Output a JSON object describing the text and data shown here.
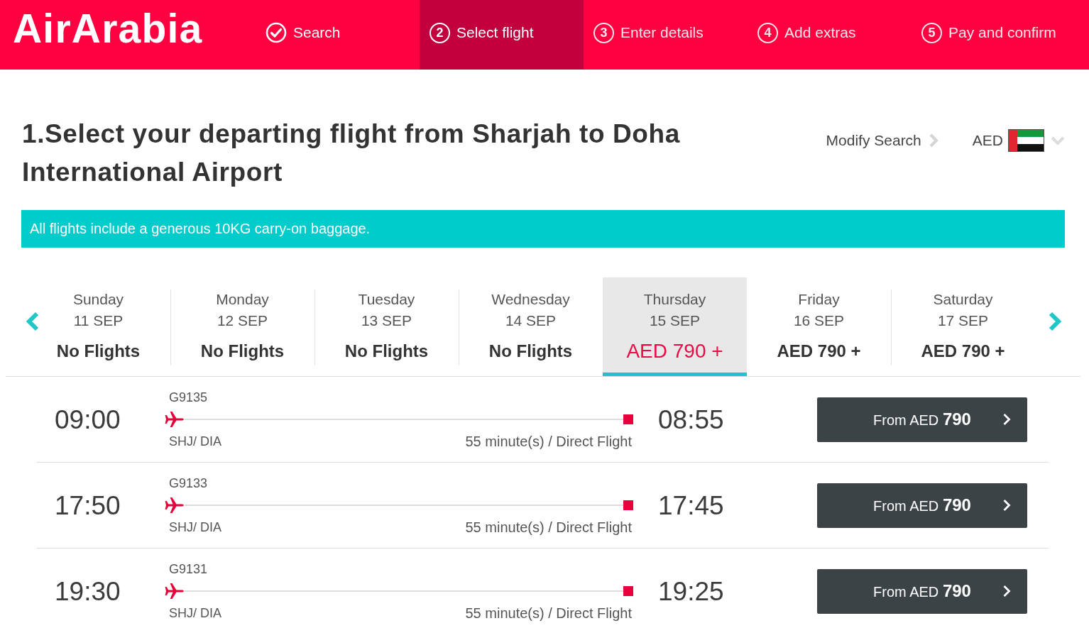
{
  "header": {
    "logo": "AirArabia",
    "steps": [
      {
        "kind": "done",
        "label": "Search",
        "selected": false
      },
      {
        "kind": "numbered",
        "number": "2",
        "label": "Select flight",
        "selected": true
      },
      {
        "kind": "numbered",
        "number": "3",
        "label": "Enter details",
        "selected": false
      },
      {
        "kind": "numbered",
        "number": "4",
        "label": "Add extras",
        "selected": false
      },
      {
        "kind": "numbered",
        "number": "5",
        "label": "Pay and confirm",
        "selected": false
      }
    ]
  },
  "heading": {
    "title": "1.Select your departing flight from Sharjah to Doha International Airport",
    "modify_search": "Modify Search",
    "currency": "AED"
  },
  "notice": "All flights include a generous 10KG carry-on baggage.",
  "date_strip": {
    "days": [
      {
        "day": "Sunday",
        "date": "11 SEP",
        "price": "No Flights",
        "selected": false
      },
      {
        "day": "Monday",
        "date": "12 SEP",
        "price": "No Flights",
        "selected": false
      },
      {
        "day": "Tuesday",
        "date": "13 SEP",
        "price": "No Flights",
        "selected": false
      },
      {
        "day": "Wednesday",
        "date": "14 SEP",
        "price": "No Flights",
        "selected": false
      },
      {
        "day": "Thursday",
        "date": "15 SEP",
        "price": "AED 790 +",
        "selected": true
      },
      {
        "day": "Friday",
        "date": "16 SEP",
        "price": "AED 790 +",
        "selected": false
      },
      {
        "day": "Saturday",
        "date": "17 SEP",
        "price": "AED 790 +",
        "selected": false
      }
    ]
  },
  "flights": [
    {
      "departure": "09:00",
      "flight_number": "G9135",
      "route": "SHJ/ DIA",
      "duration": "55 minute(s) / Direct Flight",
      "arrival": "08:55",
      "button": "From AED **790**"
    },
    {
      "departure": "17:50",
      "flight_number": "G9133",
      "route": "SHJ/ DIA",
      "duration": "55 minute(s) / Direct Flight",
      "arrival": "17:45",
      "button": "From AED **790**"
    },
    {
      "departure": "19:30",
      "flight_number": "G9131",
      "route": "SHJ/ DIA",
      "duration": "55 minute(s) / Direct Flight",
      "arrival": "19:25",
      "button": "From AED **790**"
    }
  ]
}
